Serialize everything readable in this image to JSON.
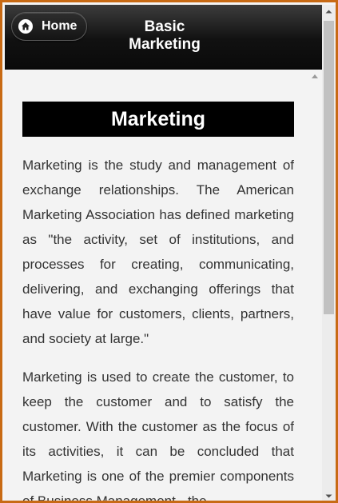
{
  "header": {
    "home_label": "Home",
    "title_line1": "Basic",
    "title_line2": "Marketing"
  },
  "content": {
    "title": "Marketing",
    "paragraphs": [
      "Marketing is the study and management of exchange relationships. The American Marketing Association has defined marketing as \"the activity, set of institutions, and processes for creating, communicating, delivering, and exchanging offerings that have value for customers, clients, partners, and society at large.\"",
      "Marketing is used to create the customer, to keep the customer and to satisfy the customer. With the customer as the focus of its activities, it can be concluded that Marketing is one of the premier components of Business Management - the"
    ]
  },
  "icons": {
    "home": "home-icon",
    "scroll_up": "scroll-up-arrow-icon",
    "scroll_down": "scroll-down-arrow-icon"
  },
  "colors": {
    "frame_border": "#c86a14",
    "header_bg": "#111111",
    "title_bar_bg": "#000000",
    "body_text": "#333333"
  }
}
